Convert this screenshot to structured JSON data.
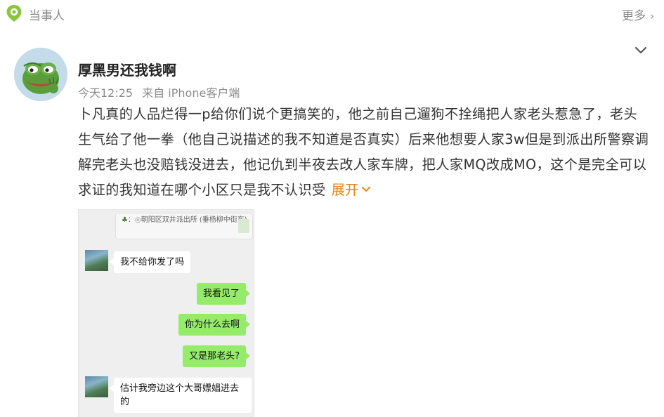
{
  "header": {
    "section_title": "当事人",
    "more_label": "更多",
    "more_icon": "chevron-right-icon",
    "logo_icon": "location-pin-logo",
    "accent": "#8cc63f"
  },
  "post": {
    "author": "厚黑男还我钱啊",
    "time": "今天12:25",
    "source": "来自 iPhone客户端",
    "text": "卜凡真的人品烂得一p给你们说个更搞笑的，他之前自己遛狗不拴绳把人家老头惹急了，老头生气给了他一拳（他自己说描述的我不知道是否真实）后来他想要人家3w但是到派出所警察调解完老头也没赔钱没进去，他记仇到半夜去改人家车牌，把人家MQ改成MO，这个是完全可以求证的我知道在哪个小区只是我不认识受",
    "expand_label": "展开",
    "expand_color": "#e8801c",
    "collapse_icon": "chevron-down-icon"
  },
  "chat": {
    "location": "朝阳区双井派出所 (垂杨柳中街东)",
    "location_prefix": "：",
    "messages": [
      {
        "side": "left",
        "text": "我不给你发了吗"
      },
      {
        "side": "right",
        "text": "我看见了"
      },
      {
        "side": "right",
        "text": "你为什么去啊"
      },
      {
        "side": "right",
        "text": "又是那老头?"
      },
      {
        "side": "left",
        "text": "估计我旁边这个大哥嫖娼进去的"
      }
    ],
    "bubble_color_right": "#95ec69",
    "bubble_color_left": "#ffffff"
  }
}
